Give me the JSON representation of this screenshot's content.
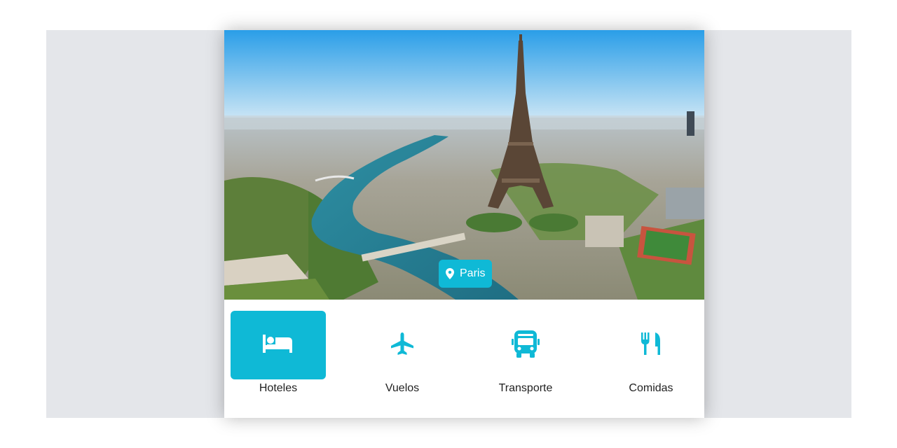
{
  "destination": {
    "name": "Paris",
    "location_icon": "map-pin-icon"
  },
  "categories": [
    {
      "label": "Hoteles",
      "icon": "bed-icon",
      "active": true
    },
    {
      "label": "Vuelos",
      "icon": "plane-icon",
      "active": false
    },
    {
      "label": "Transporte",
      "icon": "bus-icon",
      "active": false
    },
    {
      "label": "Comidas",
      "icon": "utensils-icon",
      "active": false
    }
  ],
  "colors": {
    "accent": "#0fb9d6",
    "backdrop": "#e4e6ea",
    "card": "#ffffff",
    "text": "#222222"
  }
}
